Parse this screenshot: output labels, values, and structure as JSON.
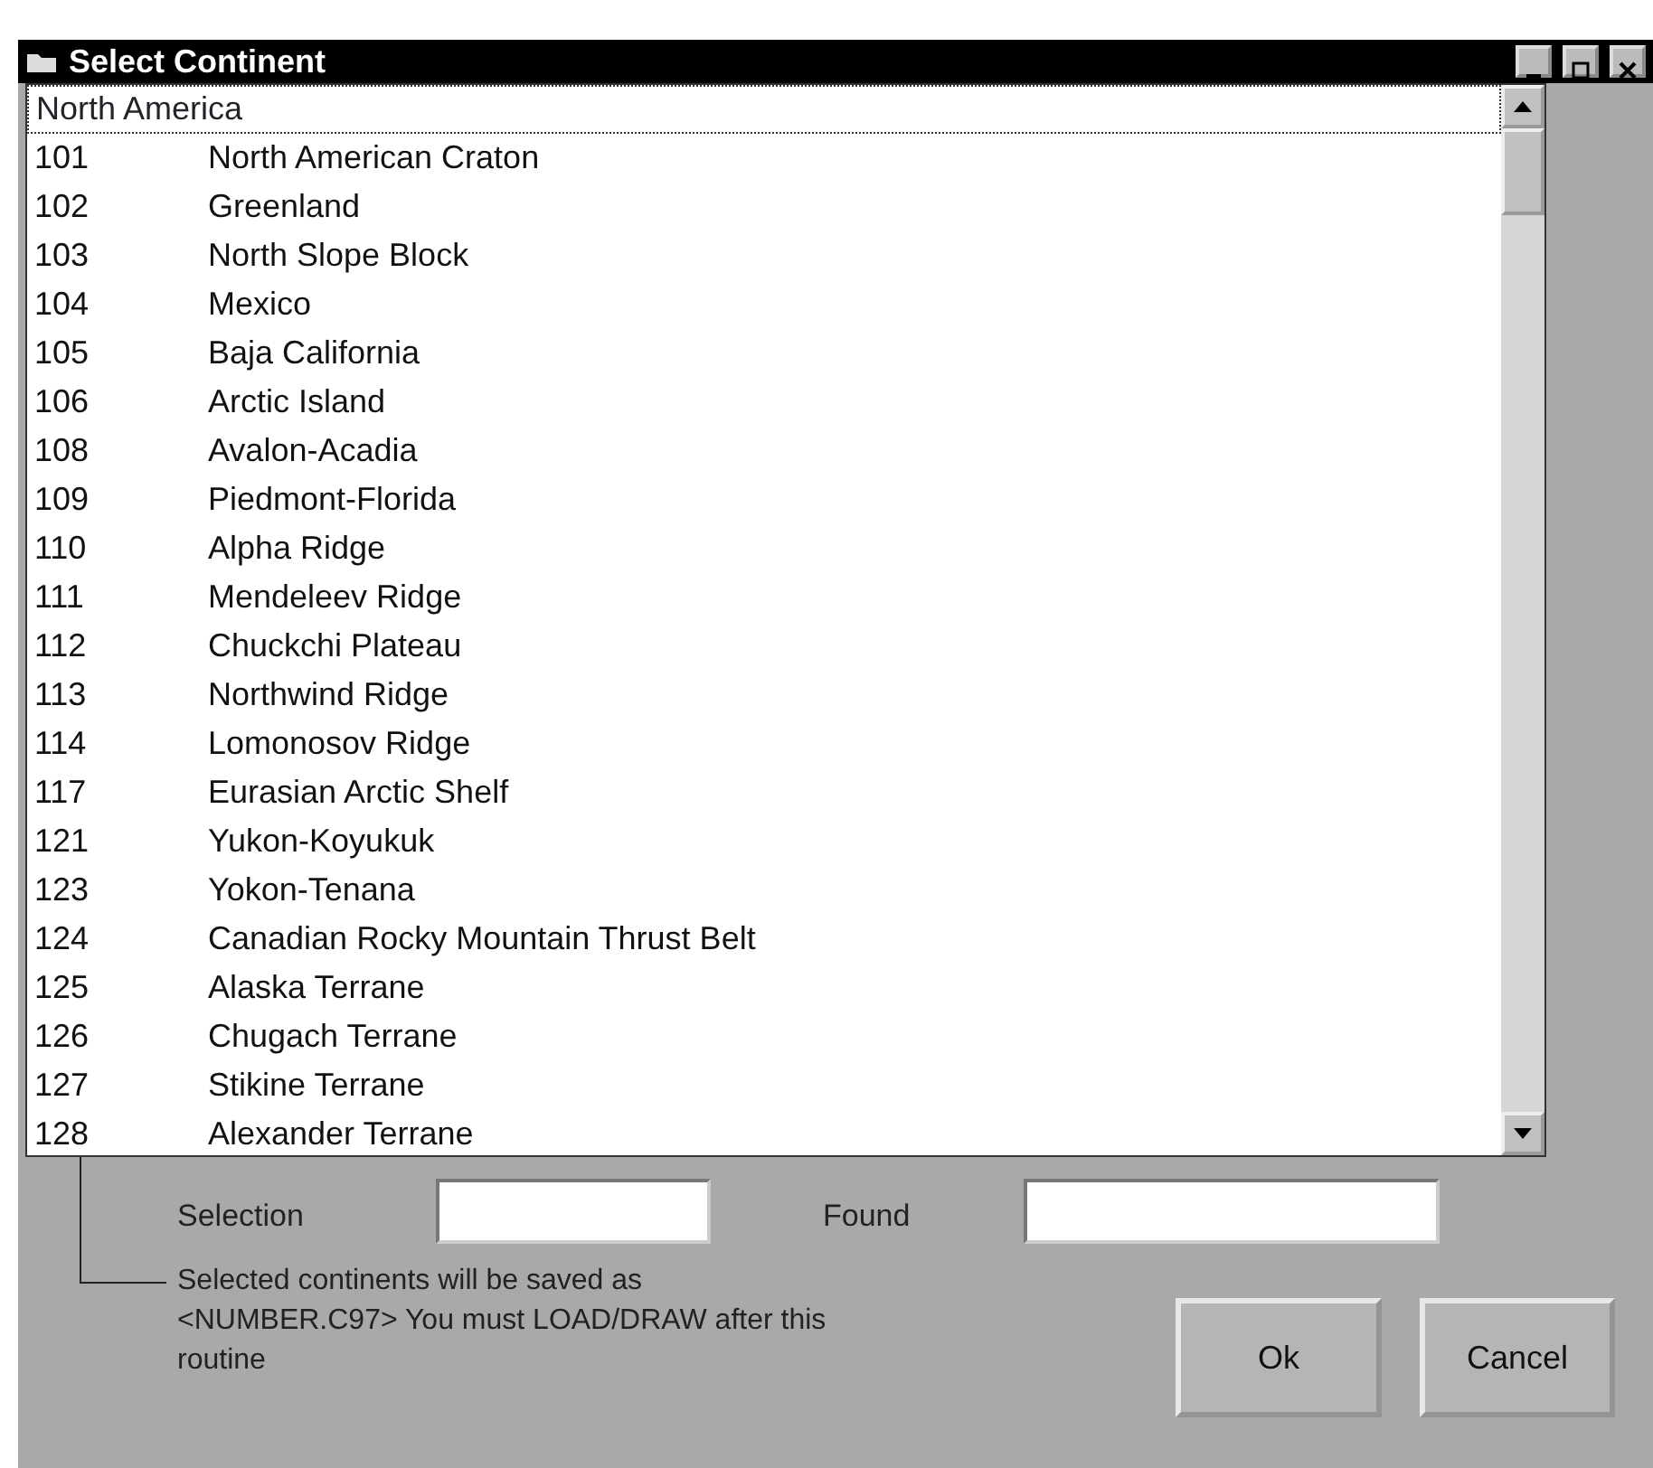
{
  "window": {
    "title": "Select Continent"
  },
  "list": {
    "header": {
      "text": "North America",
      "focused": true
    },
    "rows": [
      {
        "code": "101",
        "name": "North American Craton"
      },
      {
        "code": "102",
        "name": "Greenland"
      },
      {
        "code": "103",
        "name": "North Slope Block"
      },
      {
        "code": "104",
        "name": "Mexico"
      },
      {
        "code": "105",
        "name": "Baja California"
      },
      {
        "code": "106",
        "name": "Arctic Island"
      },
      {
        "code": "108",
        "name": "Avalon-Acadia"
      },
      {
        "code": "109",
        "name": "Piedmont-Florida"
      },
      {
        "code": "110",
        "name": "Alpha Ridge"
      },
      {
        "code": "111",
        "name": "Mendeleev Ridge"
      },
      {
        "code": "112",
        "name": "Chuckchi Plateau"
      },
      {
        "code": "113",
        "name": "Northwind Ridge"
      },
      {
        "code": "114",
        "name": "Lomonosov Ridge"
      },
      {
        "code": "117",
        "name": "Eurasian Arctic Shelf"
      },
      {
        "code": "121",
        "name": "Yukon-Koyukuk"
      },
      {
        "code": "123",
        "name": "Yokon-Tenana"
      },
      {
        "code": "124",
        "name": "Canadian Rocky Mountain Thrust Belt"
      },
      {
        "code": "125",
        "name": "Alaska Terrane"
      },
      {
        "code": "126",
        "name": "Chugach Terrane"
      },
      {
        "code": "127",
        "name": "Stikine Terrane"
      },
      {
        "code": "128",
        "name": "Alexander Terrane"
      }
    ]
  },
  "fields": [
    {
      "label": "Selection"
    },
    {
      "label": "Found"
    }
  ],
  "note": "Selected continents will be saved as <NUMBER.C97>  You must LOAD/DRAW after this routine",
  "buttons": [
    "Ok",
    "Cancel"
  ]
}
